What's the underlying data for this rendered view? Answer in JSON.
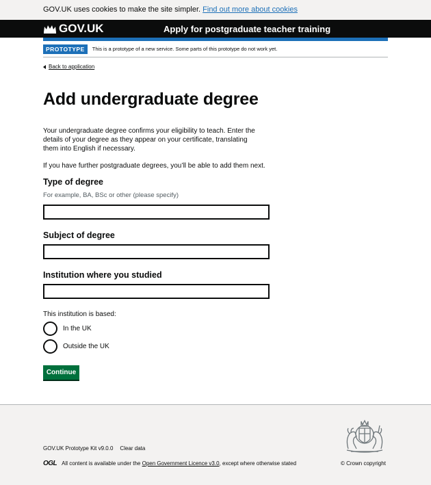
{
  "cookie_banner": {
    "text": "GOV.UK uses cookies to make the site simpler.",
    "link": "Find out more about cookies"
  },
  "header": {
    "logo_text": "GOV.UK",
    "service_name": "Apply for postgraduate teacher training"
  },
  "phase_banner": {
    "tag": "PROTOTYPE",
    "text": "This is a prototype of a new service. Some parts of this prototype do not work yet."
  },
  "back_link": "Back to application",
  "page_title": "Add undergraduate degree",
  "intro": "Your undergraduate degree confirms your eligibility to teach. Enter the details of your degree as they appear on your certificate, translating them into English if necessary.",
  "intro_2": "If you have further postgraduate degrees, you’ll be able to add them next.",
  "form": {
    "degree_type": {
      "label": "Type of degree",
      "hint": "For example, BA, BSc or other (please specify)",
      "value": ""
    },
    "subject": {
      "label": "Subject of degree",
      "value": ""
    },
    "institution": {
      "label": "Institution where you studied",
      "value": ""
    },
    "location": {
      "legend": "This institution is based:",
      "options": [
        "In the UK",
        "Outside the UK"
      ],
      "selected": null
    },
    "continue_label": "Continue"
  },
  "footer": {
    "links": [
      "GOV.UK Prototype Kit v9.0.0",
      "Clear data"
    ],
    "ogl_logo": "OGL",
    "licence_prefix": "All content is available under the",
    "licence_link": "Open Government Licence v3.0",
    "licence_suffix": ", except where otherwise stated",
    "copyright": "© Crown copyright"
  },
  "colors": {
    "brand_black": "#0b0c0c",
    "link_blue": "#1d70b8",
    "button_green": "#00703c",
    "footer_bg": "#f3f2f1"
  }
}
